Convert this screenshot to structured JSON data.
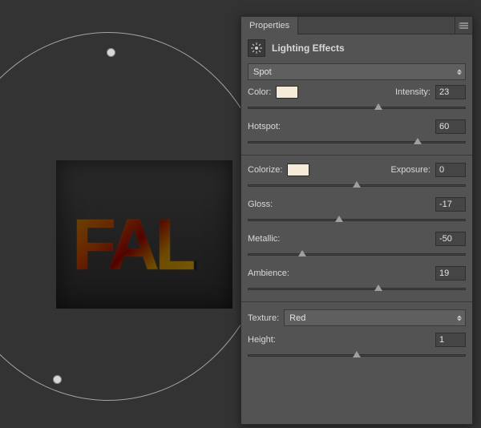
{
  "canvas": {
    "text": "FAL"
  },
  "panel": {
    "tab": "Properties",
    "title": "Lighting Effects",
    "lightType": "Spot",
    "controls": {
      "color": {
        "label": "Color:",
        "swatch": "#f4ecd8"
      },
      "intensity": {
        "label": "Intensity:",
        "value": "23",
        "sliderPct": 60
      },
      "hotspot": {
        "label": "Hotspot:",
        "value": "60",
        "sliderPct": 78
      },
      "colorize": {
        "label": "Colorize:",
        "swatch": "#f4ecd8"
      },
      "exposure": {
        "label": "Exposure:",
        "value": "0",
        "sliderPct": 50
      },
      "gloss": {
        "label": "Gloss:",
        "value": "-17",
        "sliderPct": 42
      },
      "metallic": {
        "label": "Metallic:",
        "value": "-50",
        "sliderPct": 25
      },
      "ambience": {
        "label": "Ambience:",
        "value": "19",
        "sliderPct": 60
      },
      "texture": {
        "label": "Texture:",
        "value": "Red"
      },
      "height": {
        "label": "Height:",
        "value": "1",
        "sliderPct": 50
      }
    }
  }
}
